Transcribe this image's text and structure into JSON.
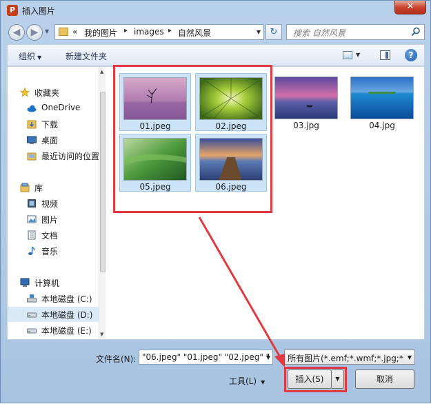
{
  "window": {
    "title": "插入图片",
    "app_icon": "powerpoint-icon",
    "close_glyph": "✕"
  },
  "address": {
    "crumb_overflow": "«",
    "crumbs": [
      "我的图片",
      "images",
      "自然风景"
    ],
    "sep": "▸"
  },
  "search": {
    "placeholder": "搜索 自然风景"
  },
  "toolbar": {
    "organize_label": "组织",
    "new_folder_label": "新建文件夹",
    "help_glyph": "?"
  },
  "nav": {
    "favorites": {
      "header": "收藏夹",
      "items": [
        "OneDrive",
        "下载",
        "桌面",
        "最近访问的位置"
      ]
    },
    "libraries": {
      "header": "库",
      "items": [
        "视频",
        "图片",
        "文档",
        "音乐"
      ]
    },
    "computer": {
      "header": "计算机",
      "items": [
        "本地磁盘 (C:)",
        "本地磁盘 (D:)",
        "本地磁盘 (E:)"
      ]
    }
  },
  "files": [
    {
      "name": "01.jpeg",
      "selected": true
    },
    {
      "name": "02.jpeg",
      "selected": true
    },
    {
      "name": "03.jpg",
      "selected": false
    },
    {
      "name": "04.jpg",
      "selected": false
    },
    {
      "name": "05.jpeg",
      "selected": true
    },
    {
      "name": "06.jpeg",
      "selected": true
    }
  ],
  "footer": {
    "filename_label": "文件名(N):",
    "filename_value": "\"06.jpeg\" \"01.jpeg\" \"02.jpeg\" \"",
    "filetype_value": "所有图片(*.emf;*.wmf;*.jpg;*.j",
    "tools_label": "工具(L)",
    "insert_label": "插入(S)",
    "cancel_label": "取消"
  },
  "colors": {
    "highlight": "#e03a40",
    "selection": "#cce4f7"
  }
}
